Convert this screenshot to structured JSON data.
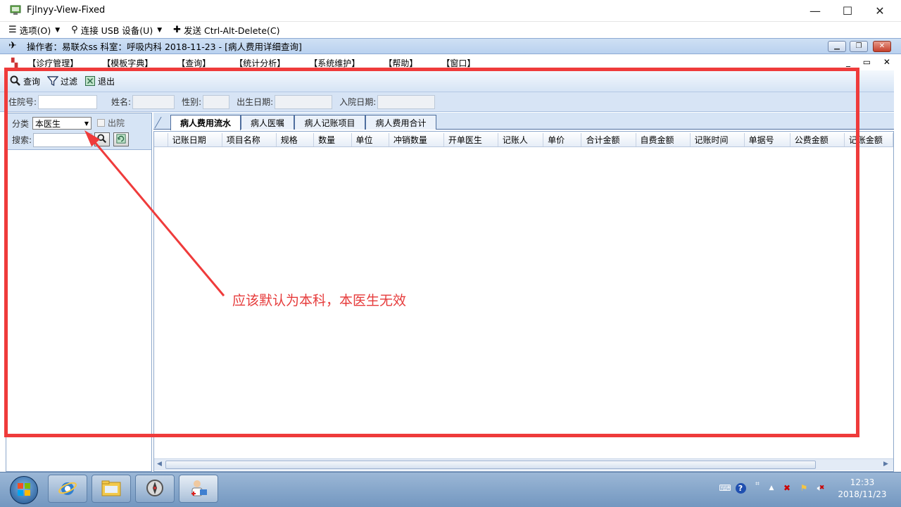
{
  "window": {
    "title": "Fjlnyy-View-Fixed",
    "minimize": "—",
    "maximize": "☐",
    "close": "✕"
  },
  "vm_toolbar": {
    "options": "选项(O)",
    "usb": "连接 USB 设备(U)",
    "send_keys": "发送 Ctrl-Alt-Delete(C)"
  },
  "app": {
    "title": "操作者：易联众ss   科室：呼吸内科   2018-11-23 - [病人费用详细查询]"
  },
  "menu": {
    "items": [
      "【诊疗管理】",
      "【模板字典】",
      "【查询】",
      "【统计分析】",
      "【系统维护】",
      "【帮助】",
      "【窗口】"
    ],
    "window_controls": "_ ▭ ✕"
  },
  "toolbar": {
    "query": "查询",
    "filter": "过滤",
    "exit": "退出"
  },
  "filters": {
    "inpatient_no": "住院号:",
    "name": "姓名:",
    "gender": "性别:",
    "birth_date": "出生日期:",
    "admit_date": "入院日期:"
  },
  "left_panel": {
    "category_label": "分类",
    "category_value": "本医生",
    "discharged_label": "出院",
    "search_label": "搜索:",
    "search_value": ""
  },
  "tabs": [
    "病人费用流水",
    "病人医嘱",
    "病人记账项目",
    "病人费用合计"
  ],
  "grid": {
    "columns": [
      "记账日期",
      "项目名称",
      "规格",
      "数量",
      "单位",
      "冲销数量",
      "开单医生",
      "记账人",
      "单价",
      "合计金额",
      "自费金额",
      "记账时间",
      "单据号",
      "公费金额",
      "记账金额"
    ]
  },
  "annotation": {
    "text": "应该默认为本科，本医生无效",
    "color": "#ef3b3b"
  },
  "taskbar": {
    "time": "12:33",
    "date": "2018/11/23"
  }
}
